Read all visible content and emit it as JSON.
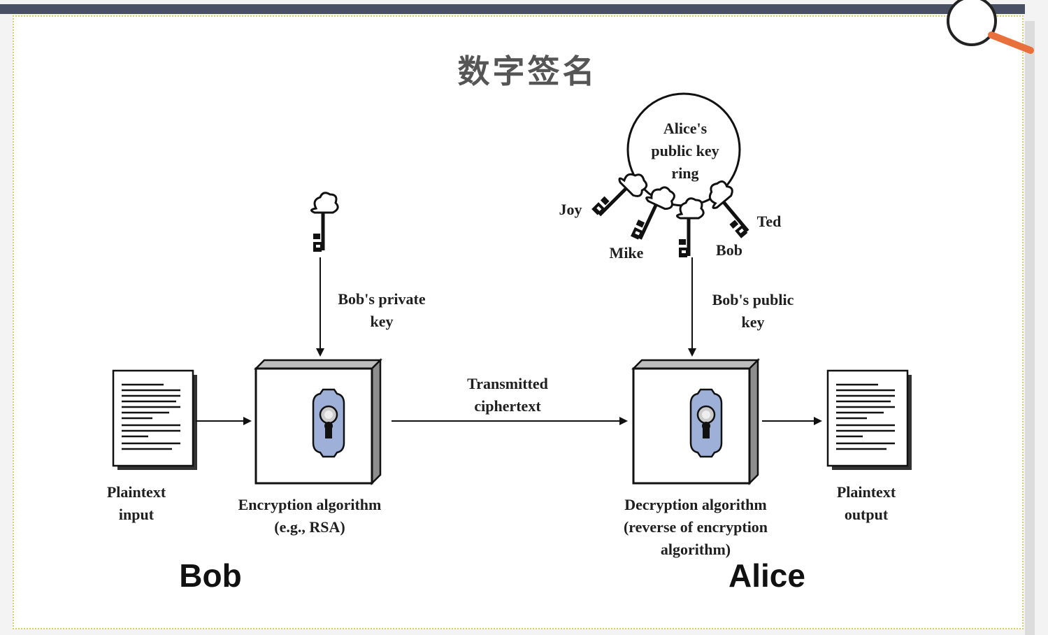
{
  "title": "数字签名",
  "labels": {
    "ring": [
      "Alice's",
      "public key",
      "ring"
    ],
    "joy": "Joy",
    "mike": "Mike",
    "ted": "Ted",
    "bob_key": "Bob",
    "private_key": [
      "Bob's private",
      "key"
    ],
    "public_key": [
      "Bob's public",
      "key"
    ],
    "transmitted": [
      "Transmitted",
      "ciphertext"
    ],
    "plaintext_input": [
      "Plaintext",
      "input"
    ],
    "encryption": [
      "Encryption algorithm",
      "(e.g., RSA)"
    ],
    "decryption": [
      "Decryption algorithm",
      "(reverse of encryption",
      "algorithm)"
    ],
    "plaintext_output": [
      "Plaintext",
      "output"
    ]
  },
  "parties": {
    "sender": "Bob",
    "receiver": "Alice"
  },
  "colors": {
    "lock_blue": "#9fb0d8",
    "magnifier_handle": "#e8703a",
    "top_bar": "#4a5063"
  },
  "icons": [
    "magnifier-icon",
    "key-icon",
    "lock-icon",
    "document-icon"
  ]
}
